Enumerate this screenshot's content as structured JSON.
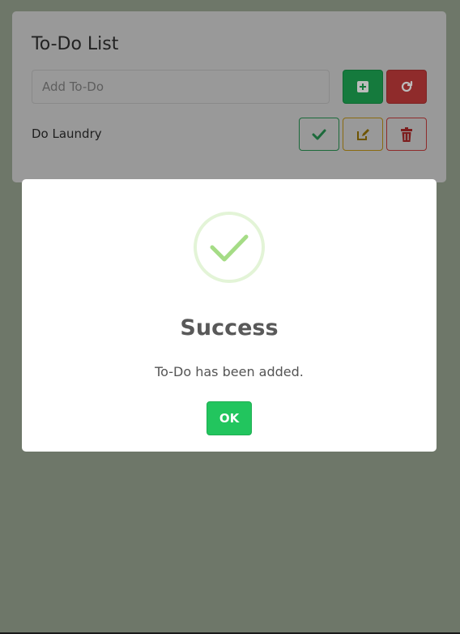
{
  "app": {
    "title": "To-Do List",
    "input": {
      "placeholder": "Add To-Do",
      "value": ""
    },
    "add_button_icon": "plus-square-icon",
    "reset_button_icon": "refresh-icon",
    "todos": [
      {
        "text": "Do Laundry",
        "actions": [
          "check-icon",
          "edit-icon",
          "trash-icon"
        ]
      }
    ]
  },
  "modal": {
    "icon": "success-check-icon",
    "title": "Success",
    "text": "To-Do has been added.",
    "ok_label": "OK"
  },
  "colors": {
    "overlay": "#6e7769",
    "card": "#999999",
    "add": "#157a3d",
    "reset": "#8f2b2b",
    "ok": "#22c55e",
    "check": "#a5dc86"
  }
}
